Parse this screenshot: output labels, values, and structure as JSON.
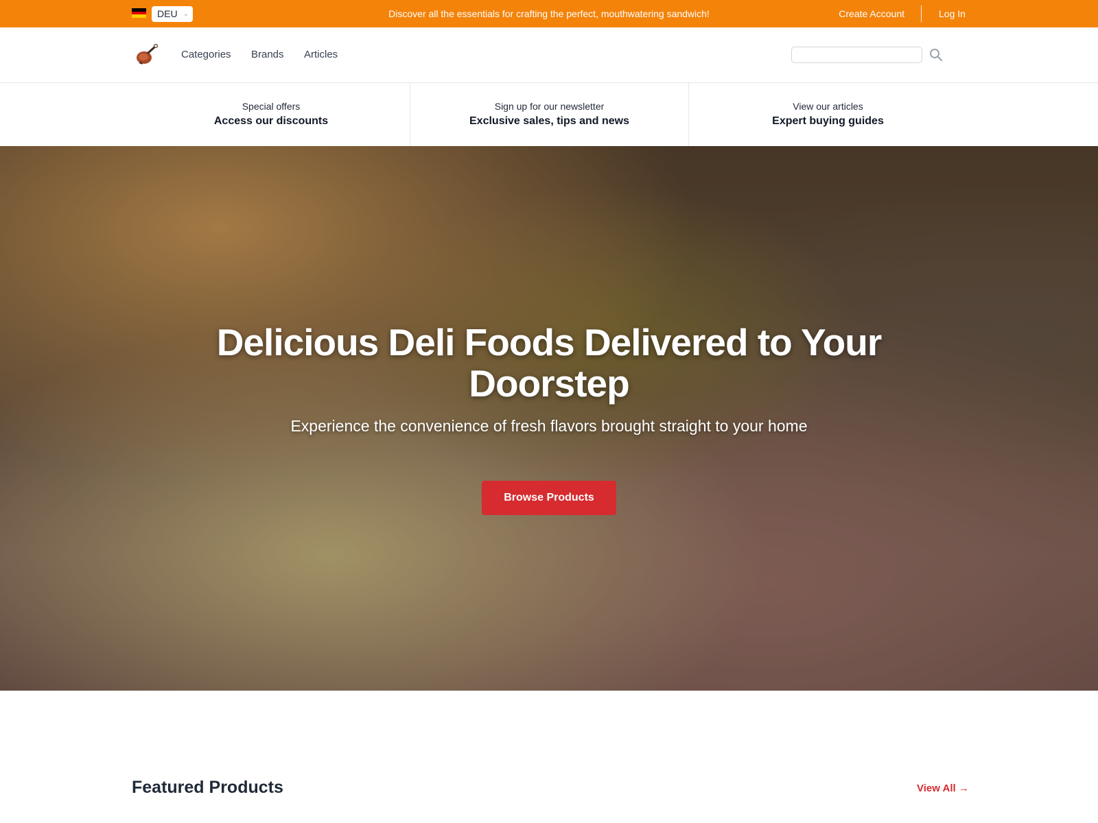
{
  "topbar": {
    "country_code": "DEU",
    "promo": "Discover all the essentials for crafting the perfect, mouthwatering sandwich!",
    "create_account": "Create Account",
    "log_in": "Log In",
    "color": "#f4830a"
  },
  "nav": {
    "items": [
      {
        "label": "Categories"
      },
      {
        "label": "Brands"
      },
      {
        "label": "Articles"
      }
    ],
    "search_placeholder": ""
  },
  "strip": [
    {
      "small": "Special offers",
      "big": "Access our discounts"
    },
    {
      "small": "Sign up for our newsletter",
      "big": "Exclusive sales, tips and news"
    },
    {
      "small": "View our articles",
      "big": "Expert buying guides"
    }
  ],
  "hero": {
    "title": "Delicious Deli Foods Delivered to Your Doorstep",
    "subtitle": "Experience the convenience of fresh flavors brought straight to your home",
    "cta": "Browse Products",
    "cta_color": "#d62b2f"
  },
  "featured": {
    "title": "Featured Products",
    "view_all": "View All →"
  },
  "icons": {
    "logo": "roast-leg-logo-icon",
    "search": "search-icon",
    "flag": "germany-flag-icon",
    "chevron": "chevron-down-icon"
  }
}
